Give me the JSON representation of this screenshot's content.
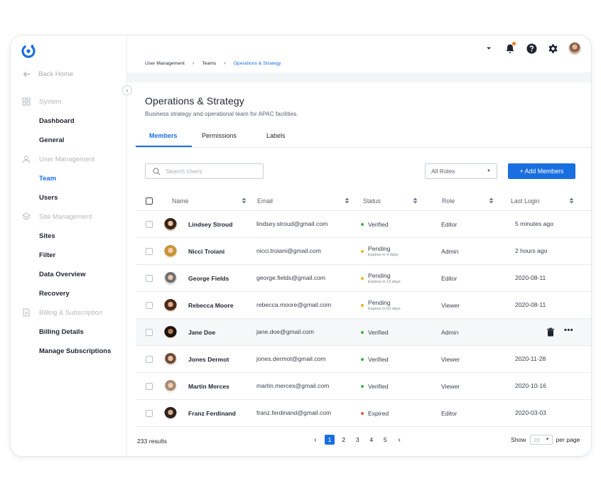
{
  "sidebar": {
    "back_home": "Back Home",
    "sections": [
      {
        "label": "System",
        "icon": "grid-icon",
        "items": [
          "Dashboard",
          "General"
        ]
      },
      {
        "label": "User Management",
        "icon": "user-icon",
        "items": [
          "Team",
          "Users"
        ]
      },
      {
        "label": "Site Management",
        "icon": "layers-icon",
        "items": [
          "Sites",
          "Filter",
          "Data Overview",
          "Recovery"
        ]
      },
      {
        "label": "Billing & Subscription",
        "icon": "document-icon",
        "items": [
          "Billing Details",
          "Manage Subscriptions"
        ]
      }
    ],
    "active_item": "Team"
  },
  "topbar": {
    "icons": [
      "caret-down-icon",
      "bell-icon",
      "help-icon",
      "gear-icon",
      "avatar"
    ],
    "notification_dot_color": "#f27c22"
  },
  "breadcrumb": [
    "User Management",
    "Teams",
    "Operations & Strategy"
  ],
  "page": {
    "title": "Operations & Strategy",
    "subtitle": "Business strategy and operational team for APAC facilities."
  },
  "tabs": [
    {
      "label": "Members",
      "active": true
    },
    {
      "label": "Permissions",
      "active": false
    },
    {
      "label": "Labels",
      "active": false
    }
  ],
  "controls": {
    "search_placeholder": "Search Users",
    "role_filter": "All Roles",
    "add_button": "+ Add Members"
  },
  "table": {
    "headers": {
      "name": "Name",
      "email": "Email",
      "status": "Status",
      "role": "Role",
      "last_login": "Last Login"
    },
    "rows": [
      {
        "name": "Lindsey Stroud",
        "email": "lindsey.stroud@gmail.com",
        "status": "Verified",
        "status_sub": "",
        "role": "Editor",
        "last_login": "5 minutes ago"
      },
      {
        "name": "Nicci Troiani",
        "email": "nicci.troiani@gmail.com",
        "status": "Pending",
        "status_sub": "Expires in 4 days",
        "role": "Admin",
        "last_login": "2 hours ago"
      },
      {
        "name": "George Fields",
        "email": "george.fields@gmail.com",
        "status": "Pending",
        "status_sub": "Expires in 13 days",
        "role": "Editor",
        "last_login": "2020-08-11"
      },
      {
        "name": "Rebecca Moore",
        "email": "rebecca.moore@gmail.com",
        "status": "Pending",
        "status_sub": "Expires in 02 days",
        "role": "Viewer",
        "last_login": "2020-08-11"
      },
      {
        "name": "Jane Doe",
        "email": "jane.doe@gmail.com",
        "status": "Verified",
        "status_sub": "",
        "role": "Admin",
        "last_login": ""
      },
      {
        "name": "Jones Dermot",
        "email": "jones.dermot@gmail.com",
        "status": "Verified",
        "status_sub": "",
        "role": "Viewer",
        "last_login": "2020-11-28"
      },
      {
        "name": "Martin Merces",
        "email": "martin.merces@gmail.com",
        "status": "Verified",
        "status_sub": "",
        "role": "Viewer",
        "last_login": "2020-10-16"
      },
      {
        "name": "Franz Ferdinand",
        "email": "franz.ferdinand@gmail.com",
        "status": "Expired",
        "status_sub": "",
        "role": "Editor",
        "last_login": "2020-03-03"
      }
    ],
    "hover_row_actions": [
      "trash-icon",
      "more-icon"
    ],
    "status_colors": {
      "Verified": "#3cb043",
      "Pending": "#f2b21c",
      "Expired": "#e8513c"
    }
  },
  "footer": {
    "results": "233 results",
    "pages": [
      "1",
      "2",
      "3",
      "4",
      "5"
    ],
    "current_page": "1",
    "show_label": "Show",
    "per_page_value": "20",
    "per_page_label": "per page"
  },
  "colors": {
    "accent": "#1a6fe0"
  }
}
